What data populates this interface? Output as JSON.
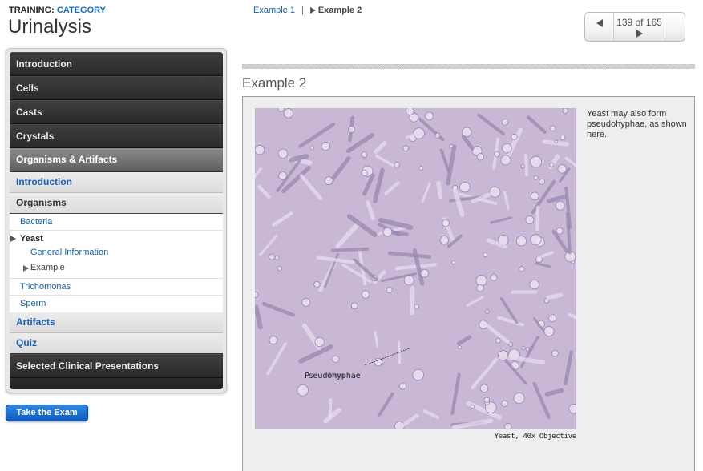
{
  "header": {
    "training_label": "TRAINING:",
    "category_label": "CATEGORY",
    "title": "Urinalysis"
  },
  "breadcrumb": {
    "prev_link": "Example 1",
    "separator": "|",
    "current": "Example 2"
  },
  "pager": {
    "text": "139 of 165",
    "prev_icon": "triangle-left",
    "next_icon": "triangle-right"
  },
  "sidebar": {
    "sections": [
      {
        "label": "Introduction"
      },
      {
        "label": "Cells"
      },
      {
        "label": "Casts"
      },
      {
        "label": "Crystals"
      }
    ],
    "active_section": "Organisms & Artifacts",
    "sub_intro": "Introduction",
    "sub_organisms": "Organisms",
    "organisms": {
      "bacteria": "Bacteria",
      "yeast": "Yeast",
      "yeast_children": {
        "general": "General Information",
        "example": "Example"
      },
      "trichomonas": "Trichomonas",
      "sperm": "Sperm"
    },
    "sub_artifacts": "Artifacts",
    "sub_quiz": "Quiz",
    "last_section": "Selected Clinical Presentations"
  },
  "exam_button": "Take the Exam",
  "main": {
    "title": "Example 2",
    "description": "Yeast may also form pseudohyphae, as shown here.",
    "image_label": "Pseudohyphae",
    "image_caption": "Yeast, 40x Objective"
  },
  "colors": {
    "link_blue": "#1a5fa6",
    "category_blue": "#1a6bbf",
    "button_blue": "#0d5bc0",
    "sidebar_dark": "#2c2c2c",
    "panel_bg": "#eeeeee",
    "micro_bg": "#c9b9d8"
  }
}
